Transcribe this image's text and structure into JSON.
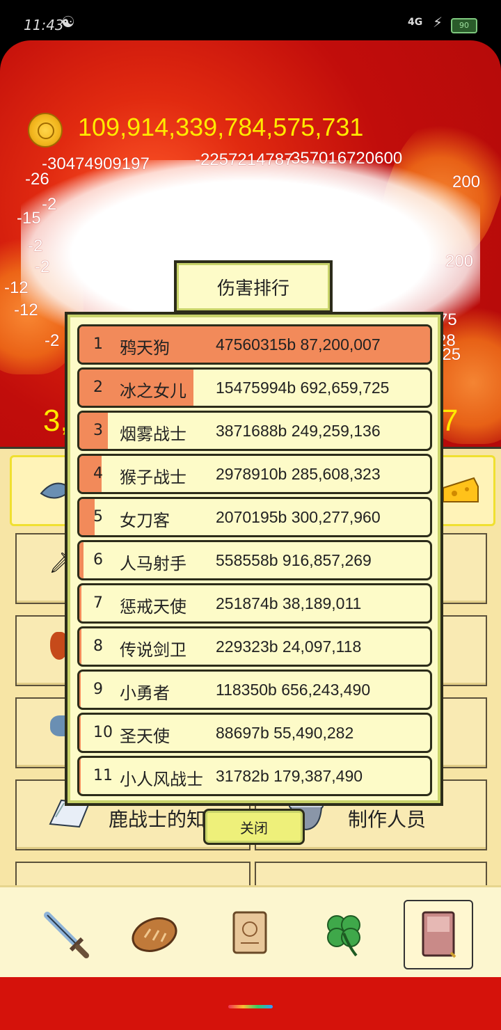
{
  "status_bar": {
    "time": "11:43",
    "network": "4G",
    "battery": "90"
  },
  "game": {
    "gold": "109,914,339,784,575,731",
    "damage_numbers": [
      "-30474909197",
      "-26",
      "-2257214787",
      "-357016720600",
      "-15",
      "-2",
      "-2",
      "-12",
      "-12",
      "-2",
      "-2",
      "200",
      "200",
      "75",
      "28",
      "925"
    ],
    "big_number_left": "3,",
    "big_number_right": "7"
  },
  "menu": {
    "knowledge_label": "鹿战士的知识",
    "credits_label": "制作人员"
  },
  "modal": {
    "title": "伤害排行",
    "close_label": "关闭",
    "rows": [
      {
        "rank": "1",
        "name": "鸦天狗",
        "value": "47560315b 87,200,007",
        "fraction": 1.0
      },
      {
        "rank": "2",
        "name": "冰之女儿",
        "value": "15475994b 692,659,725",
        "fraction": 0.325
      },
      {
        "rank": "3",
        "name": "烟雾战士",
        "value": "3871688b 249,259,136",
        "fraction": 0.081
      },
      {
        "rank": "4",
        "name": "猴子战士",
        "value": "2978910b 285,608,323",
        "fraction": 0.063
      },
      {
        "rank": "5",
        "name": "女刀客",
        "value": "2070195b 300,277,960",
        "fraction": 0.044
      },
      {
        "rank": "6",
        "name": "人马射手",
        "value": "558558b 916,857,269",
        "fraction": 0.012
      },
      {
        "rank": "7",
        "name": "惩戒天使",
        "value": "251874b 38,189,011",
        "fraction": 0.005
      },
      {
        "rank": "8",
        "name": "传说剑卫",
        "value": "229323b 24,097,118",
        "fraction": 0.005
      },
      {
        "rank": "9",
        "name": "小勇者",
        "value": "118350b 656,243,490",
        "fraction": 0.002
      },
      {
        "rank": "10",
        "name": "圣天使",
        "value": "88697b 55,490,282",
        "fraction": 0.002
      },
      {
        "rank": "11",
        "name": "小人风战士",
        "value": "31782b 179,387,490",
        "fraction": 0.001
      }
    ]
  },
  "bottom_nav": [
    {
      "icon": "sword-icon"
    },
    {
      "icon": "bread-icon"
    },
    {
      "icon": "scroll-icon"
    },
    {
      "icon": "clover-icon"
    },
    {
      "icon": "book-icon",
      "active": true
    }
  ]
}
